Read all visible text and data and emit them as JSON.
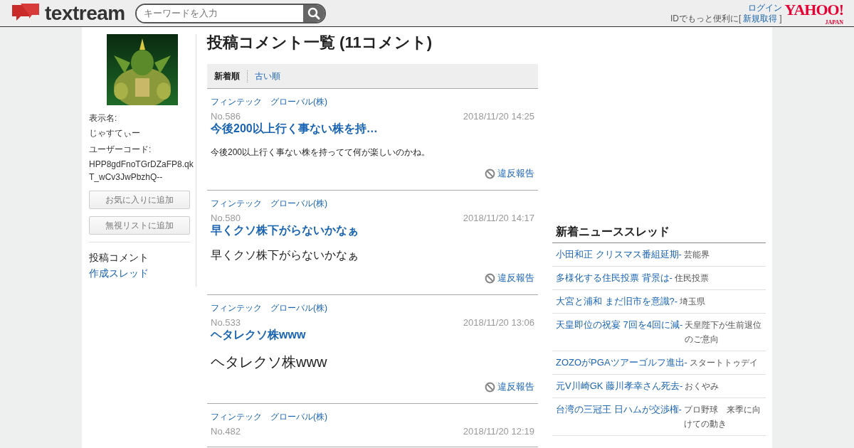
{
  "header": {
    "logo": "textream",
    "search": {
      "placeholder": "キーワードを入力"
    },
    "login": "ログイン",
    "id_prompt": "IDでもっと便利に[",
    "signup": "新規取得",
    "id_prompt_end": "]",
    "yahoo_logo": "YAHOO!",
    "yahoo_sub": "JAPAN"
  },
  "profile": {
    "name_label": "表示名:",
    "name": "じゃすてぃー",
    "code_label": "ユーザーコード:",
    "code": "HPP8gdFnoTGrDZaFP8.qkT_wCv3JwPbzhQ--",
    "buttons": [
      "お気に入りに追加",
      "無視リストに追加"
    ],
    "nav": [
      {
        "label": "投稿コメント",
        "selected": true
      },
      {
        "label": "作成スレッド",
        "selected": false
      }
    ]
  },
  "main": {
    "title": "投稿コメント一覧 (11コメント)",
    "sort_tabs": [
      {
        "label": "新着順",
        "selected": true
      },
      {
        "label": "古い順",
        "selected": false
      }
    ],
    "comments": [
      {
        "board": "フィンテック　グローバル(株)",
        "number": "No.586",
        "date": "2018/11/20 14:25",
        "title": "今後200以上行く事ない株を持…",
        "body": "今後200以上行く事ない株を持ってて何が楽しいのかね。",
        "kind": "small",
        "report": "違反報告"
      },
      {
        "board": "フィンテック　グローバル(株)",
        "number": "No.580",
        "date": "2018/11/20 14:17",
        "title": "早くクソ株下がらないかなぁ",
        "body": "早くクソ株下がらないかなぁ",
        "kind": "medium",
        "report": "違反報告"
      },
      {
        "board": "フィンテック　グローバル(株)",
        "number": "No.533",
        "date": "2018/11/20 13:06",
        "title": "ヘタレクソ株www",
        "body": "ヘタレクソ株www",
        "kind": "large",
        "report": "違反報告"
      },
      {
        "board": "フィンテック　グローバル(株)",
        "number": "No.482",
        "date": "2018/11/20 12:19"
      }
    ]
  },
  "news": {
    "title": "新着ニューススレッド",
    "items": [
      {
        "headline": "小田和正 クリスマス番組延期-",
        "category": "芸能界"
      },
      {
        "headline": "多様化する住民投票 背景は-",
        "category": "住民投票"
      },
      {
        "headline": "大宮と浦和 まだ旧市を意識?-",
        "category": "埼玉県"
      },
      {
        "headline": "天皇即位の祝宴 7回を4回に減-",
        "category": "天皇陛下が生前退位のご意向"
      },
      {
        "headline": "ZOZOがPGAツアーゴルフ進出-",
        "category": "スタートトゥデイ"
      },
      {
        "headline": "元V川崎GK 藤川孝幸さん死去-",
        "category": "おくやみ"
      },
      {
        "headline": "台湾の三冠王 日ハムが交渉権-",
        "category": "プロ野球　来季に向けての動き"
      }
    ]
  }
}
